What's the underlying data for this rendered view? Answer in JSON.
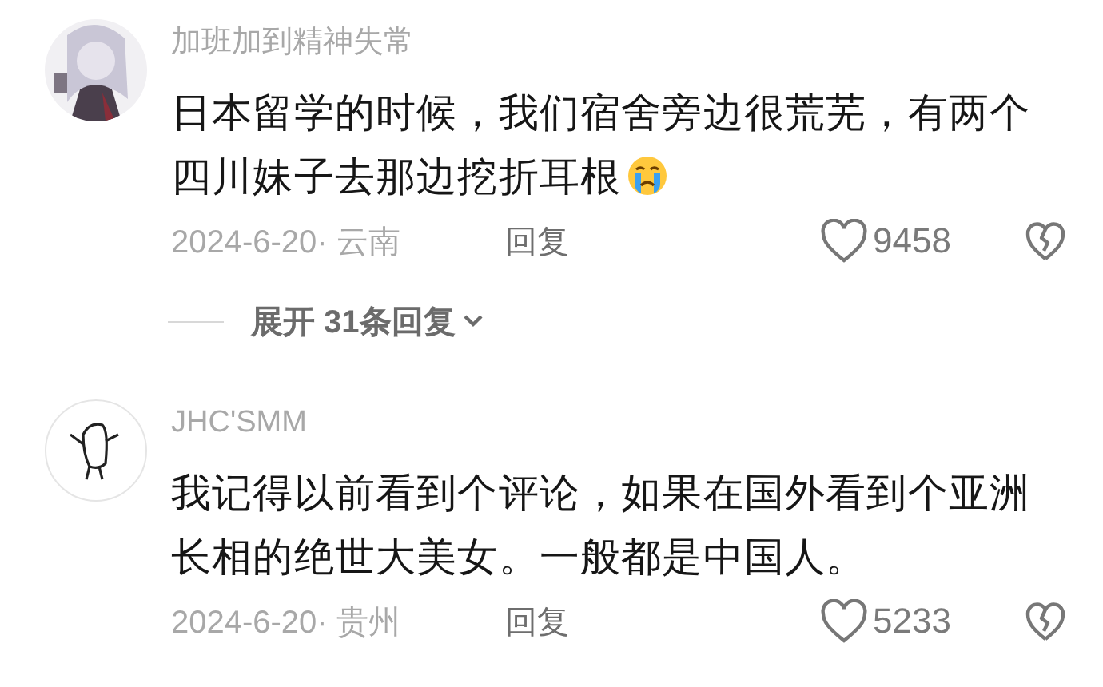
{
  "comments": [
    {
      "username": "加班加到精神失常",
      "avatar": {
        "kind": "character"
      },
      "text": "日本留学的时候，我们宿舍旁边很荒芜，有两个四川妹子去那边挖折耳根",
      "end_icon": {
        "kind": "crying"
      },
      "meta": "2024-6-20· 云南",
      "reply": "回复",
      "likes": "9458",
      "expand": "展开 31条回复"
    },
    {
      "username": "JHC'SMM",
      "avatar": {
        "kind": "doodle"
      },
      "text": "我记得以前看到个评论，如果在国外看到个亚洲长相的绝世大美女。一般都是中国人。",
      "meta": "2024-6-20· 贵州",
      "reply": "回复",
      "likes": "5233"
    }
  ]
}
